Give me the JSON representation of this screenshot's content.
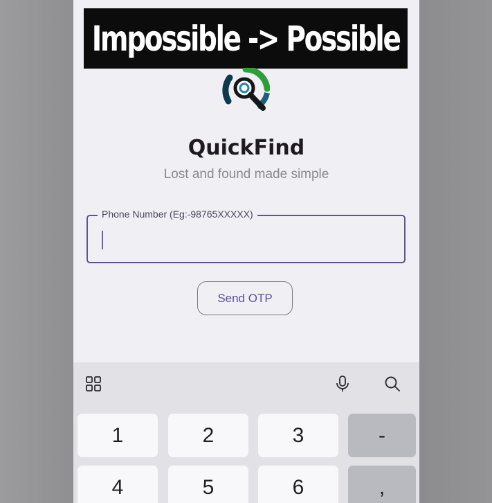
{
  "overlay": {
    "banner_text": "Impossible -> Possible"
  },
  "app": {
    "logo_icon": "magnifier-logo-icon",
    "title": "QuickFind",
    "subtitle": "Lost and found made simple"
  },
  "form": {
    "phone_label": "Phone Number (Eg:-98765XXXXX)",
    "phone_value": "",
    "send_button": "Send OTP"
  },
  "keyboard": {
    "toolbar": {
      "left_icon": "apps-grid-icon",
      "right_icons": [
        "microphone-icon",
        "search-icon"
      ]
    },
    "rows": [
      [
        "1",
        "2",
        "3",
        "-"
      ],
      [
        "4",
        "5",
        "6",
        ","
      ]
    ]
  },
  "colors": {
    "accent": "#5b5590",
    "button_text": "#5a4f9a",
    "background": "#f0eff4",
    "keyboard_bg": "#e1e1e6"
  }
}
